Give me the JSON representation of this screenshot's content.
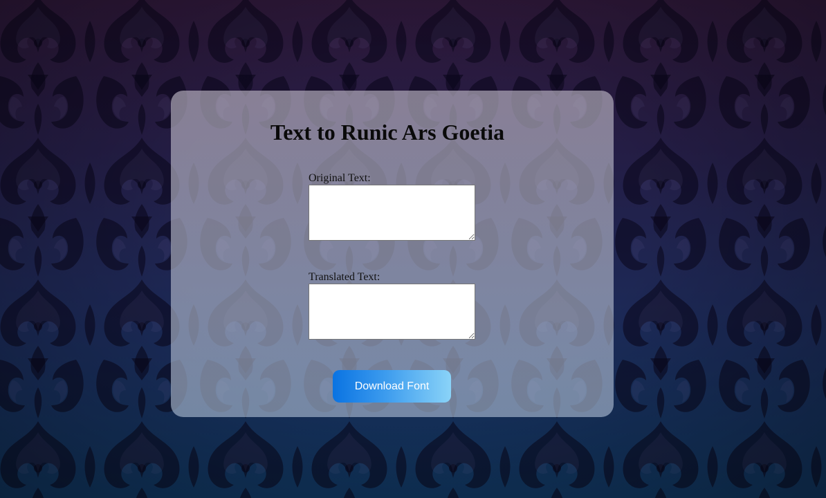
{
  "page": {
    "title": "Text to Runic Ars Goetia"
  },
  "form": {
    "original_label": "Original Text:",
    "original_value": "",
    "translated_label": "Translated Text:",
    "translated_value": "",
    "download_button": "Download Font"
  },
  "theme": {
    "background_top": "#2e1839",
    "background_bottom": "#10365f",
    "button_gradient_start": "#0a73e2",
    "button_gradient_end": "#8ad3f8"
  }
}
